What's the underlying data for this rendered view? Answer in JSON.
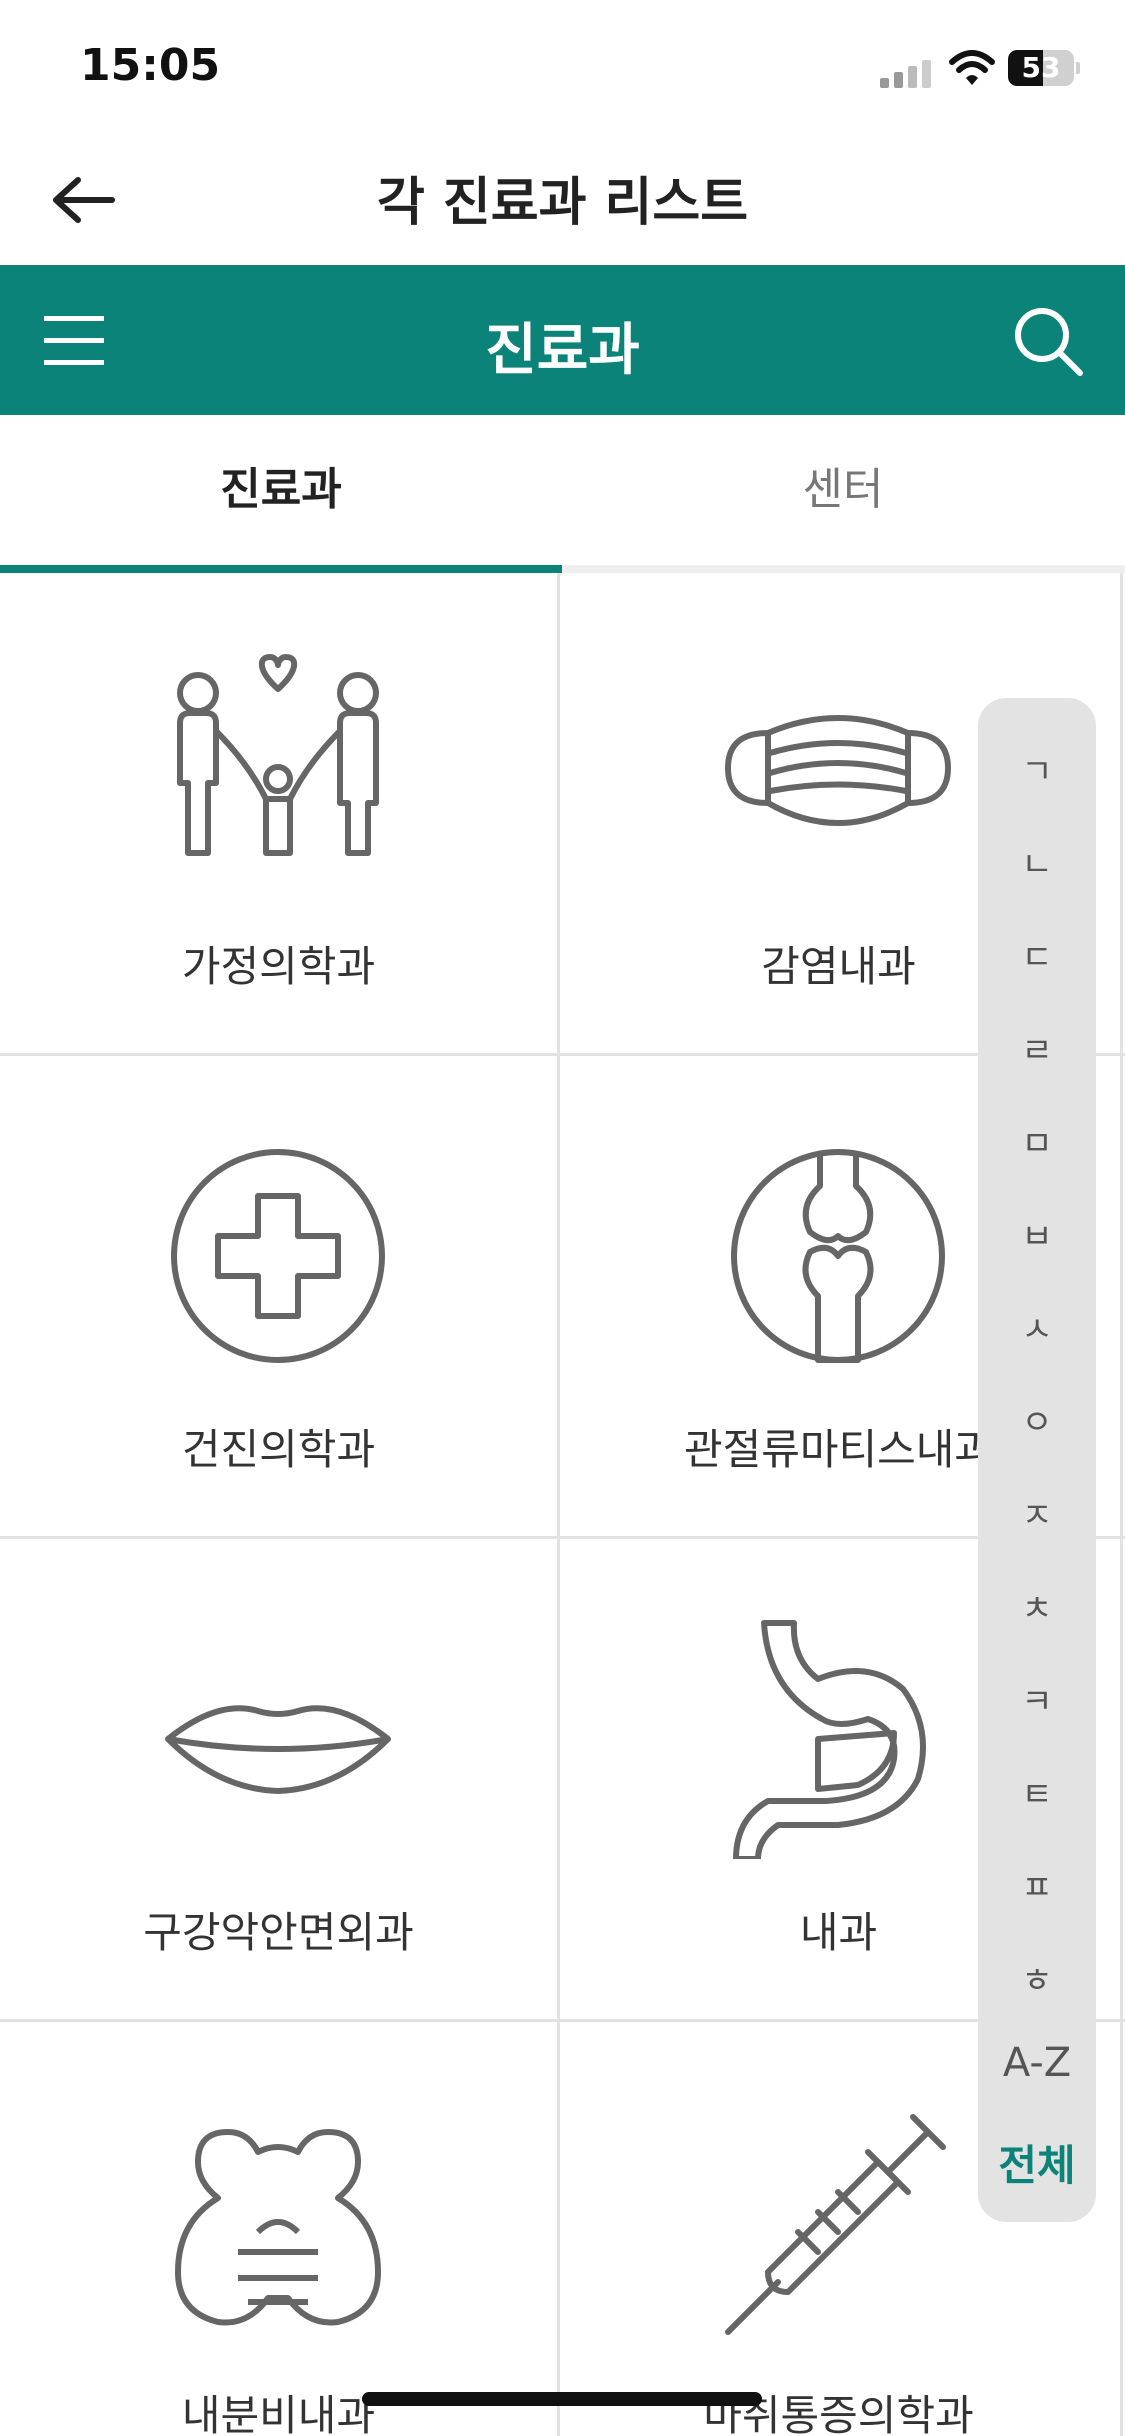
{
  "status_bar": {
    "time": "15:05",
    "battery_level": "53",
    "battery_fraction": 0.53
  },
  "nav": {
    "title": "각 진료과 리스트"
  },
  "header": {
    "title": "진료과"
  },
  "tabs": [
    {
      "label": "진료과",
      "selected": true
    },
    {
      "label": "센터",
      "selected": false
    }
  ],
  "departments": [
    {
      "label": "가정의학과",
      "icon": "family-icon"
    },
    {
      "label": "감염내과",
      "icon": "face-mask-icon"
    },
    {
      "label": "건진의학과",
      "icon": "medical-cross-icon"
    },
    {
      "label": "관절류마티스내과",
      "icon": "joint-bone-icon"
    },
    {
      "label": "구강악안면외과",
      "icon": "lips-icon"
    },
    {
      "label": "내과",
      "icon": "stomach-icon"
    },
    {
      "label": "내분비내과",
      "icon": "thyroid-icon"
    },
    {
      "label": "마취통증의학과",
      "icon": "syringe-icon"
    }
  ],
  "index": {
    "items": [
      "ㄱ",
      "ㄴ",
      "ㄷ",
      "ㄹ",
      "ㅁ",
      "ㅂ",
      "ㅅ",
      "ㅇ",
      "ㅈ",
      "ㅊ",
      "ㅋ",
      "ㅌ",
      "ㅍ",
      "ㅎ"
    ],
    "az": "A-Z",
    "all": "전체"
  },
  "colors": {
    "accent": "#0b8379",
    "icon_stroke": "#666666"
  }
}
